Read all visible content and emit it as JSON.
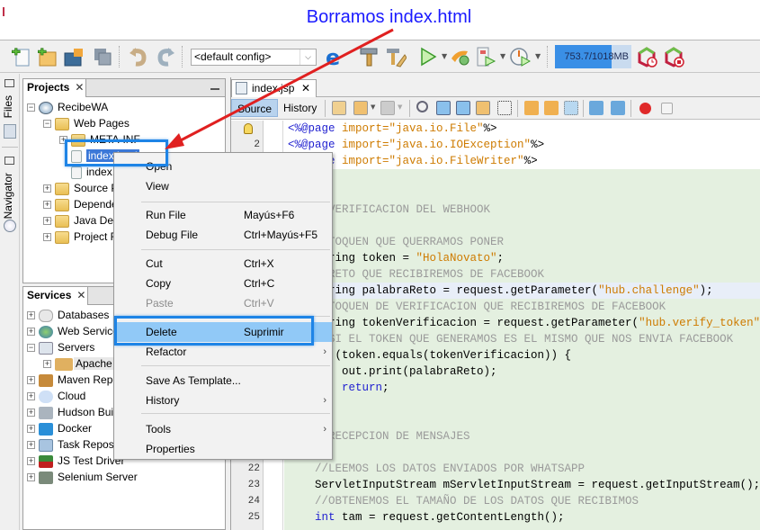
{
  "annotation": {
    "title": "Borramos index.html",
    "arrow_color": "#e02020",
    "callout_color": "#1e84e6"
  },
  "toolbar": {
    "config_select": "<default config>",
    "memory": {
      "used": "753.7",
      "total": "1018MB",
      "label": "753.7/1018MB",
      "fraction_used": 0.74
    },
    "icons": [
      "new-file-icon",
      "new-project-icon",
      "open-project-icon",
      "save-all-icon",
      "undo-icon",
      "redo-icon",
      "browser-icon",
      "build-icon",
      "clean-build-icon",
      "run-icon",
      "deploy-icon",
      "debug-icon",
      "profile-icon",
      "gc-icon",
      "stop-gc-icon"
    ]
  },
  "left_strip": {
    "tabs": [
      "Files",
      "Navigator"
    ]
  },
  "projects_panel": {
    "tab_label": "Projects",
    "tree": [
      {
        "label": "RecibeWA",
        "level": 0,
        "expanded": true
      },
      {
        "label": "Web Pages",
        "level": 1,
        "expanded": true
      },
      {
        "label": "META-INF",
        "level": 2,
        "expanded": false
      },
      {
        "label": "index.html",
        "level": 2,
        "selected": true
      },
      {
        "label": "index.jsp",
        "level": 2
      },
      {
        "label": "Source Packages",
        "level": 1,
        "expanded": false
      },
      {
        "label": "Dependencies",
        "level": 1,
        "expanded": false
      },
      {
        "label": "Java Dependencies",
        "level": 1,
        "expanded": false
      },
      {
        "label": "Project Files",
        "level": 1,
        "expanded": false
      }
    ]
  },
  "services_panel": {
    "tab_label": "Services",
    "tree": [
      {
        "label": "Databases",
        "level": 0
      },
      {
        "label": "Web Services",
        "level": 0
      },
      {
        "label": "Servers",
        "level": 0,
        "expanded": true
      },
      {
        "label": "Apache Tomcat",
        "level": 1
      },
      {
        "label": "Maven Repositories",
        "level": 0
      },
      {
        "label": "Cloud",
        "level": 0
      },
      {
        "label": "Hudson Builders",
        "level": 0
      },
      {
        "label": "Docker",
        "level": 0
      },
      {
        "label": "Task Repositories",
        "level": 0
      },
      {
        "label": "JS Test Driver",
        "level": 0
      },
      {
        "label": "Selenium Server",
        "level": 0
      }
    ]
  },
  "context_menu": {
    "items": [
      {
        "label": "Open",
        "shortcut": ""
      },
      {
        "label": "View",
        "shortcut": ""
      },
      {
        "label": "Run File",
        "shortcut": "Mayús+F6"
      },
      {
        "label": "Debug File",
        "shortcut": "Ctrl+Mayús+F5"
      },
      {
        "label": "Cut",
        "shortcut": "Ctrl+X"
      },
      {
        "label": "Copy",
        "shortcut": "Ctrl+C"
      },
      {
        "label": "Paste",
        "shortcut": "Ctrl+V",
        "disabled": true
      },
      {
        "label": "Delete",
        "shortcut": "Suprimir",
        "highlighted": true
      },
      {
        "label": "Refactor",
        "shortcut": "",
        "submenu": true
      },
      {
        "label": "Save As Template...",
        "shortcut": ""
      },
      {
        "label": "History",
        "shortcut": "",
        "submenu": true
      },
      {
        "label": "Tools",
        "shortcut": "",
        "submenu": true
      },
      {
        "label": "Properties",
        "shortcut": ""
      }
    ],
    "submenu_arrow": "›"
  },
  "editor": {
    "tab_label": "index.jsp",
    "views": [
      "Source",
      "History"
    ],
    "active_view": "Source",
    "line_numbers": {
      "first_visible": [
        "",
        "2"
      ],
      "bottom": [
        "22",
        "23",
        "24",
        "25"
      ]
    },
    "code_lines": [
      {
        "parts": [
          [
            "kw",
            "<%@page "
          ],
          [
            "str",
            "import=\"java.io.File\""
          ],
          [
            "",
            "%>"
          ]
        ]
      },
      {
        "parts": [
          [
            "kw",
            "<%@page "
          ],
          [
            "str",
            "import=\"java.io.IOException\""
          ],
          [
            "",
            "%>"
          ]
        ]
      },
      {
        "parts": [
          [
            "kw",
            "<%@page "
          ],
          [
            "str",
            "import=\"java.io.FileWriter\""
          ],
          [
            "",
            "%>"
          ]
        ]
      },
      {
        "parts": [
          [
            "",
            ""
          ]
        ]
      },
      {
        "parts": [
          [
            "",
            ""
          ]
        ]
      },
      {
        "parts": [
          [
            "cm",
            "    //VERIFICACION DEL WEBHOOK"
          ]
        ]
      },
      {
        "parts": [
          [
            "",
            ""
          ]
        ]
      },
      {
        "parts": [
          [
            "cm",
            "    //TOQUEN QUE QUERRAMOS PONER"
          ]
        ]
      },
      {
        "parts": [
          [
            "",
            "    String token = "
          ],
          [
            "str",
            "\"HolaNovato\""
          ],
          [
            "",
            ";"
          ]
        ]
      },
      {
        "parts": [
          [
            "cm",
            "    //RETO QUE RECIBIREMOS DE FACEBOOK"
          ]
        ]
      },
      {
        "parts": [
          [
            "",
            "    String palabraReto = request.getParameter("
          ],
          [
            "str",
            "\"hub.challenge\""
          ],
          [
            "",
            ");"
          ]
        ],
        "highlight": true
      },
      {
        "parts": [
          [
            "cm",
            "    //TOQUEN DE VERIFICACION QUE RECIBIREMOS DE FACEBOOK"
          ]
        ]
      },
      {
        "parts": [
          [
            "",
            "    String tokenVerificacion = request.getParameter("
          ],
          [
            "str",
            "\"hub.verify_token\""
          ],
          [
            "",
            ");"
          ]
        ]
      },
      {
        "parts": [
          [
            "cm",
            "    //SI EL TOKEN QUE GENERAMOS ES EL MISMO QUE NOS ENVIA FACEBOOK"
          ]
        ]
      },
      {
        "parts": [
          [
            "",
            "    if (token.equals(tokenVerificacion)) {"
          ]
        ]
      },
      {
        "parts": [
          [
            "",
            "        out.print(palabraReto);"
          ]
        ]
      },
      {
        "parts": [
          [
            "kw",
            "        return"
          ],
          [
            "",
            ";"
          ]
        ]
      },
      {
        "parts": [
          [
            "",
            "    }"
          ]
        ]
      },
      {
        "parts": [
          [
            "",
            ""
          ]
        ]
      },
      {
        "parts": [
          [
            "cm",
            "    //RECEPCION DE MENSAJES"
          ]
        ]
      },
      {
        "parts": [
          [
            "",
            ""
          ]
        ]
      },
      {
        "parts": [
          [
            "cm",
            "    //LEEMOS LOS DATOS ENVIADOS POR WHATSAPP"
          ]
        ]
      },
      {
        "parts": [
          [
            "",
            "    ServletInputStream mServletInputStream = request.getInputStream();"
          ]
        ]
      },
      {
        "parts": [
          [
            "cm",
            "    //OBTENEMOS EL TAMAÑO DE LOS DATOS QUE RECIBIMOS"
          ]
        ]
      },
      {
        "parts": [
          [
            "kw",
            "    int"
          ],
          [
            "",
            " tam = request.getContentLength();"
          ]
        ]
      }
    ]
  }
}
